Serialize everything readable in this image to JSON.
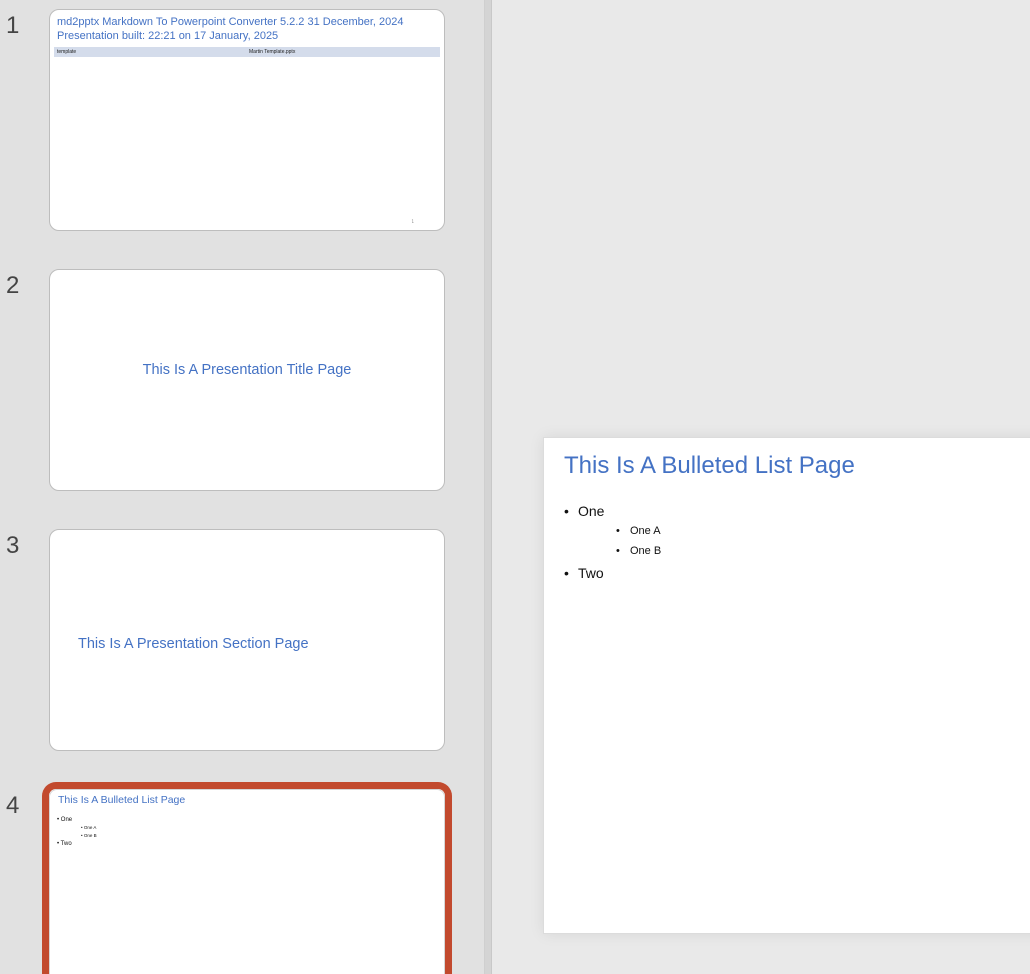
{
  "thumbnails": [
    {
      "number": "1",
      "title_line1": "md2pptx Markdown To Powerpoint Converter 5.2.2 31 December, 2024",
      "title_line2": "Presentation built: 22:21 on 17 January, 2025",
      "table_key": "template",
      "table_value": "Martin Template.pptx",
      "page_number": "1"
    },
    {
      "number": "2",
      "title": "This Is A Presentation Title Page"
    },
    {
      "number": "3",
      "title": "This Is A Presentation Section Page"
    },
    {
      "number": "4",
      "title": "This Is A Bulleted List Page",
      "selected": true,
      "bullets": [
        "One",
        "One A",
        "One B",
        "Two"
      ]
    }
  ],
  "main_slide": {
    "title": "This Is A Bulleted List Page",
    "bullet_symbol": "•",
    "bullets": [
      {
        "text": "One",
        "level": 1
      },
      {
        "text": "One A",
        "level": 2
      },
      {
        "text": "One B",
        "level": 2
      },
      {
        "text": "Two",
        "level": 1
      }
    ]
  },
  "colors": {
    "accent_blue": "#4472c4",
    "selection_border": "#c24a2e"
  }
}
